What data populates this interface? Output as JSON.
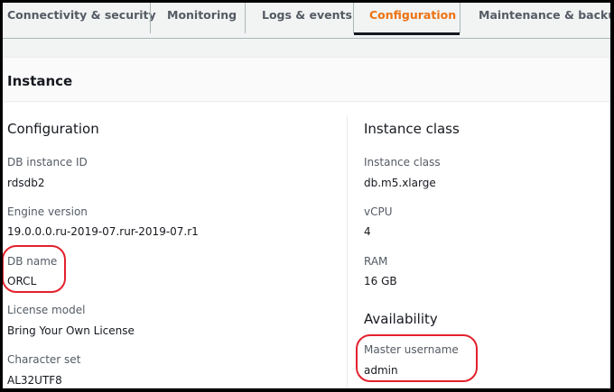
{
  "tabs": [
    "Connectivity & security",
    "Monitoring",
    "Logs & events",
    "Configuration",
    "Maintenance & backups"
  ],
  "active_tab": "Configuration",
  "panel": {
    "title": "Instance"
  },
  "left": {
    "heading": "Configuration",
    "fields": [
      {
        "label": "DB instance ID",
        "value": "rdsdb2"
      },
      {
        "label": "Engine version",
        "value": "19.0.0.0.ru-2019-07.rur-2019-07.r1"
      },
      {
        "label": "DB name",
        "value": "ORCL"
      },
      {
        "label": "License model",
        "value": "Bring Your Own License"
      },
      {
        "label": "Character set",
        "value": "AL32UTF8"
      }
    ]
  },
  "right": {
    "heading": "Instance class",
    "fields": [
      {
        "label": "Instance class",
        "value": "db.m5.xlarge"
      },
      {
        "label": "vCPU",
        "value": "4"
      },
      {
        "label": "RAM",
        "value": "16 GB"
      }
    ],
    "heading2": "Availability",
    "fields2": [
      {
        "label": "Master username",
        "value": "admin"
      }
    ]
  },
  "colors": {
    "accent": "#ec7211",
    "highlight": "#e3212d"
  }
}
